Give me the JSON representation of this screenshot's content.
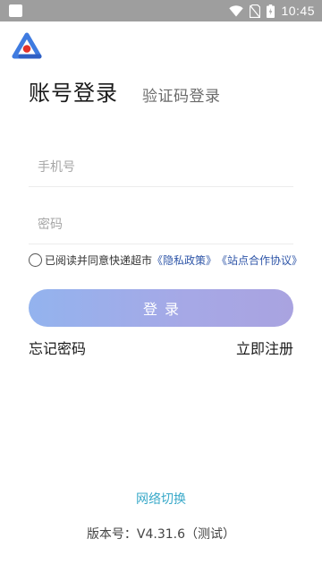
{
  "status_bar": {
    "time": "10:45",
    "icons": [
      "notification-square-icon",
      "wifi-icon",
      "no-sim-icon",
      "battery-icon"
    ]
  },
  "colors": {
    "status_bar": "#9e9e9e",
    "link": "#2f56a8",
    "network_link": "#39a9c9",
    "button_gradient_start": "#93b3ee",
    "button_gradient_end": "#a9a3e0"
  },
  "tabs": {
    "account_login": "账号登录",
    "code_login": "验证码登录"
  },
  "form": {
    "phone_placeholder": "手机号",
    "password_placeholder": "密码",
    "agreement_text": "已阅读并同意快递超市",
    "privacy_link": "《隐私政策》",
    "site_agreement_link": "《站点合作协议》",
    "agreement_checked": false
  },
  "buttons": {
    "login": "登录",
    "forgot_password": "忘记密码",
    "register": "立即注册"
  },
  "footer": {
    "network_switch": "网络切换",
    "version": "版本号：V4.31.6（测试）"
  }
}
